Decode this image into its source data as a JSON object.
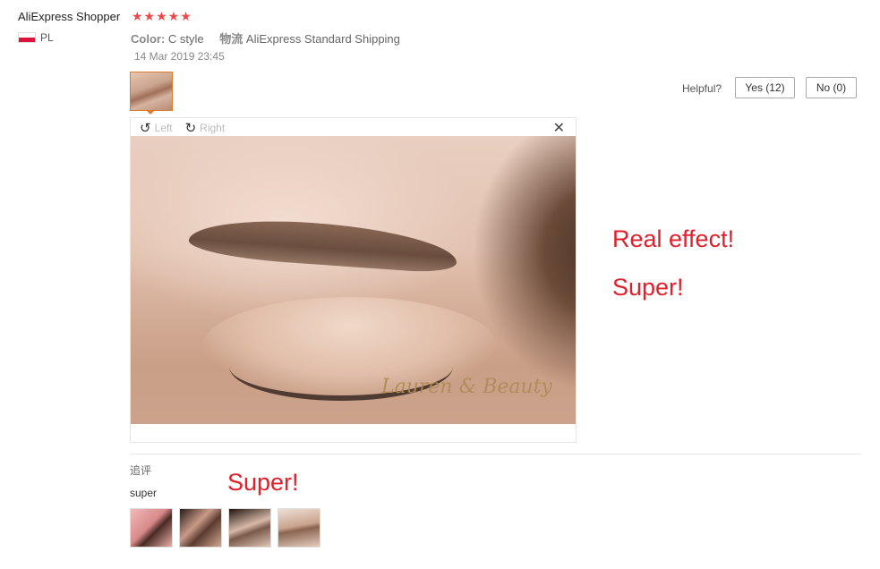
{
  "review": {
    "shopper_name": "AliExpress Shopper",
    "stars": "★★★★★",
    "rating": 5,
    "country_code": "PL",
    "color_label": "Color:",
    "color_value": "C style",
    "shipping_label": "物流",
    "shipping_value": "AliExpress Standard Shipping",
    "date": "14 Mar 2019 23:45"
  },
  "helpful": {
    "label": "Helpful?",
    "yes_label": "Yes (12)",
    "no_label": "No (0)"
  },
  "viewer": {
    "rotate_left_icon": "↺",
    "rotate_left_label": "Left",
    "rotate_right_icon": "↻",
    "rotate_right_label": "Right",
    "close_icon": "✕",
    "watermark": "Lauren & Beauty"
  },
  "overlays": {
    "text1": "Real effect!",
    "text2": "Super!",
    "text3": "Super!"
  },
  "followup": {
    "label": "追评",
    "text": "super"
  },
  "colors": {
    "star": "#f04848",
    "overlay_red": "#e0202c",
    "selected_border": "#e07a2b"
  }
}
